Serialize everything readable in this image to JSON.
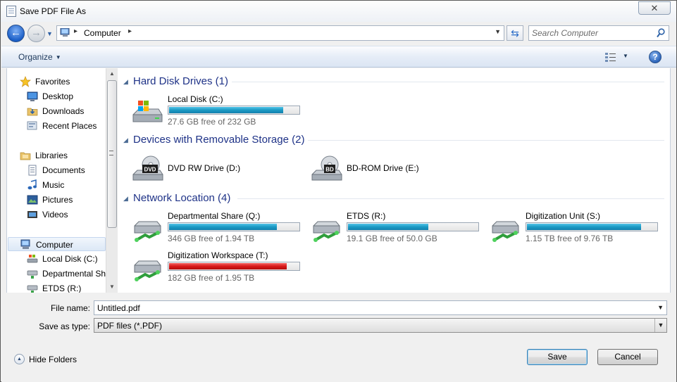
{
  "window": {
    "title": "Save PDF File As",
    "close_symbol": "✕"
  },
  "address": {
    "location": "Computer",
    "search_placeholder": "Search Computer"
  },
  "toolbar": {
    "organize_label": "Organize"
  },
  "nav": {
    "items": [
      {
        "label": "Favorites",
        "icon": "star-icon"
      },
      {
        "label": "Desktop",
        "icon": "desktop-icon"
      },
      {
        "label": "Downloads",
        "icon": "downloads-folder-icon"
      },
      {
        "label": "Recent Places",
        "icon": "recent-places-icon"
      },
      {
        "label": "Libraries",
        "icon": "libraries-icon"
      },
      {
        "label": "Documents",
        "icon": "documents-icon"
      },
      {
        "label": "Music",
        "icon": "music-icon"
      },
      {
        "label": "Pictures",
        "icon": "pictures-icon"
      },
      {
        "label": "Videos",
        "icon": "videos-icon"
      },
      {
        "label": "Computer",
        "icon": "computer-icon"
      },
      {
        "label": "Local Disk (C:)",
        "icon": "local-disk-icon"
      },
      {
        "label": "Departmental Sh",
        "icon": "network-drive-icon"
      },
      {
        "label": "ETDS (R:)",
        "icon": "network-drive-icon"
      }
    ]
  },
  "groups": {
    "hdd": {
      "name": "Hard Disk Drives (1)",
      "drives": [
        {
          "name": "Local Disk (C:)",
          "free": "27.6 GB free of 232 GB",
          "used_fraction": 0.88,
          "warn": false
        }
      ]
    },
    "removable": {
      "name": "Devices with Removable Storage (2)",
      "drives": [
        {
          "name": "DVD RW Drive (D:)",
          "badge": "DVD"
        },
        {
          "name": "BD-ROM Drive (E:)",
          "badge": "BD"
        }
      ]
    },
    "network": {
      "name": "Network Location (4)",
      "drives": [
        {
          "name": "Departmental Share (Q:)",
          "free": "346 GB free of 1.94 TB",
          "used_fraction": 0.83,
          "warn": false
        },
        {
          "name": "ETDS (R:)",
          "free": "19.1 GB free of 50.0 GB",
          "used_fraction": 0.62,
          "warn": false
        },
        {
          "name": "Digitization Unit (S:)",
          "free": "1.15 TB free of 9.76 TB",
          "used_fraction": 0.88,
          "warn": false
        },
        {
          "name": "Digitization Workspace (T:)",
          "free": "182 GB free of 1.95 TB",
          "used_fraction": 0.91,
          "warn": true
        }
      ]
    }
  },
  "form": {
    "file_name_label": "File name:",
    "file_name_value": "Untitled.pdf",
    "save_type_label": "Save as type:",
    "save_type_value": "PDF files (*.PDF)"
  },
  "footer": {
    "hide_folders_label": "Hide Folders",
    "save_label": "Save",
    "cancel_label": "Cancel"
  },
  "colors": {
    "accent": "#1e3287",
    "bar_fill": "#1b9ac4",
    "bar_warn": "#d81919"
  }
}
